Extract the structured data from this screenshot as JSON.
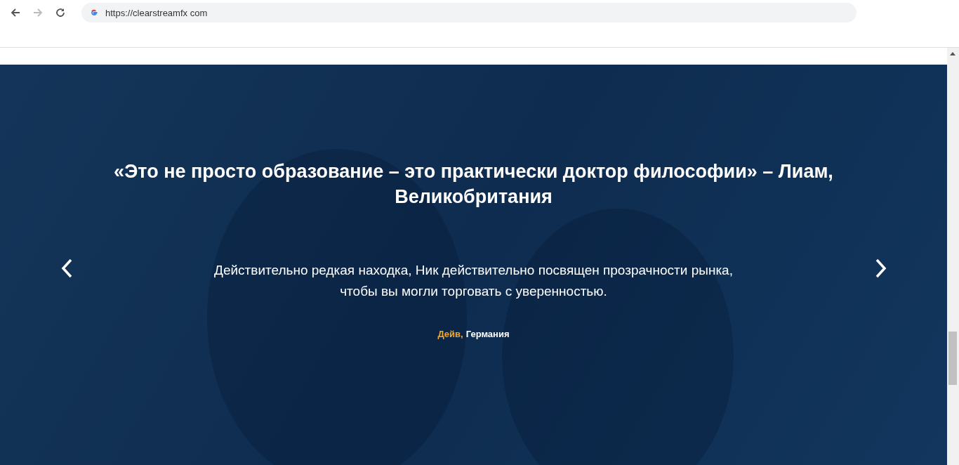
{
  "browser": {
    "url": "https://clearstreamfx com"
  },
  "testimonial": {
    "heading": "«Это не просто образование – это практически доктор философии» – Лиам, Великобритания",
    "quote": "Действительно редкая находка, Ник действительно посвящен прозрачности рынка, чтобы вы могли торговать с уверенностью.",
    "author_name": "Дейв,",
    "author_location": "Германия"
  }
}
